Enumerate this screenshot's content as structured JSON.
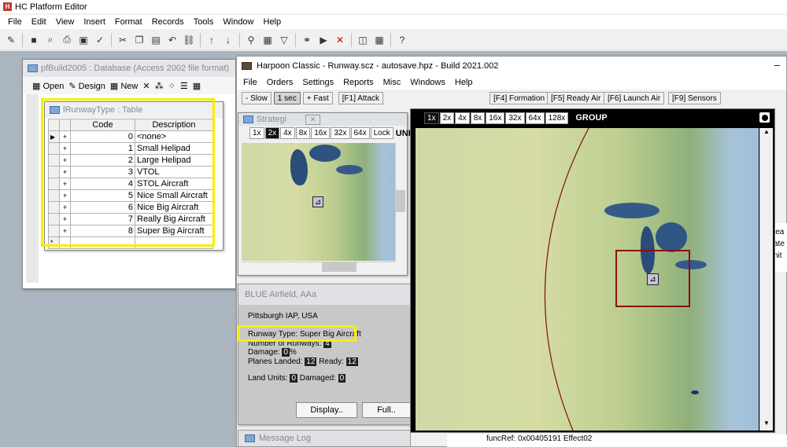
{
  "app": {
    "title": "HC Platform Editor",
    "menu": [
      "File",
      "Edit",
      "View",
      "Insert",
      "Format",
      "Records",
      "Tools",
      "Window",
      "Help"
    ]
  },
  "db_window": {
    "title": "pfBuild2005 : Database (Access 2002 file format)",
    "open": "Open",
    "design": "Design",
    "new": "New"
  },
  "table_window": {
    "title": "lRunwayType : Table",
    "headers": [
      "Code",
      "Description"
    ],
    "rows": [
      {
        "code": "0",
        "desc": "<none>"
      },
      {
        "code": "1",
        "desc": "Small Helipad"
      },
      {
        "code": "2",
        "desc": "Large Helipad"
      },
      {
        "code": "3",
        "desc": "VTOL"
      },
      {
        "code": "4",
        "desc": "STOL Aircraft"
      },
      {
        "code": "5",
        "desc": "Nice Small Aircraft"
      },
      {
        "code": "6",
        "desc": "Nice Big Aircraft"
      },
      {
        "code": "7",
        "desc": "Really Big Aircraft"
      },
      {
        "code": "8",
        "desc": "Super Big Aircraft"
      }
    ],
    "expand": "+",
    "new_row": "*"
  },
  "harpoon": {
    "title": "Harpoon Classic - Runway.scz - autosave.hpz - Build 2021.002",
    "menu": [
      "File",
      "Orders",
      "Settings",
      "Reports",
      "Misc",
      "Windows",
      "Help"
    ],
    "speed": [
      "- Slow",
      "1 sec",
      "+ Fast"
    ],
    "attack": "[F1] Attack",
    "fkeys": [
      "[F4] Formation",
      "[F5] Ready Air",
      "[F6] Launch Air",
      "[F9] Sensors"
    ],
    "minimize": "–"
  },
  "strategic": {
    "title": "Strategi",
    "zoom": [
      "1x",
      "2x",
      "4x",
      "8x",
      "16x",
      "32x",
      "64x",
      "Lock"
    ],
    "trail": "UNI"
  },
  "group_map": {
    "zoom": [
      "1x",
      "2x",
      "4x",
      "8x",
      "16x",
      "32x",
      "64x",
      "128x"
    ],
    "label": "GROUP"
  },
  "airfield": {
    "title": "BLUE Airfield, AAa",
    "location": "Pittsburgh IAP, USA",
    "runway_type": "Runway Type: Super Big Aircraft",
    "num_runways_label": "Number of Runways:",
    "num_runways": "4",
    "damage_label": "Damage:",
    "damage": "0",
    "damage_unit": "%",
    "planes_landed_label": "Planes Landed:",
    "planes_landed": "12",
    "ready_label": "Ready:",
    "ready": "12",
    "land_units_label": "Land Units:",
    "land_units": "0",
    "damaged_label": "Damaged:",
    "damaged": "0",
    "display_btn": "Display..",
    "full_btn": "Full.."
  },
  "message_log": {
    "title": "Message Log"
  },
  "status": {
    "funcref": "funcRef: 0x00405191 Effect02"
  },
  "right_peek": [
    "lea",
    "ate",
    "nit"
  ]
}
